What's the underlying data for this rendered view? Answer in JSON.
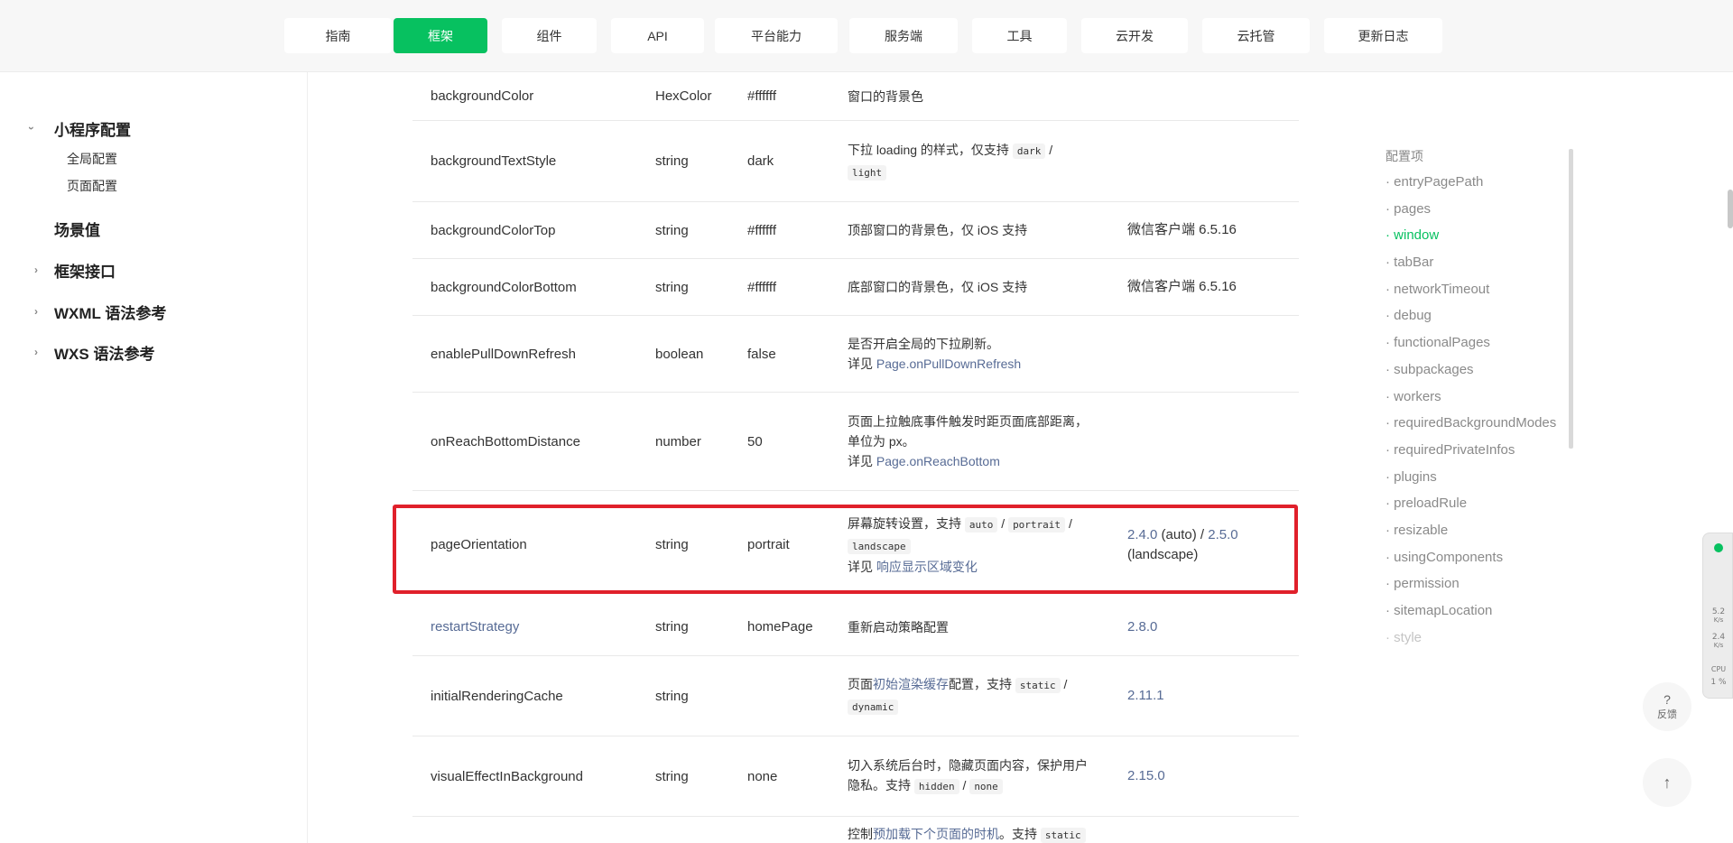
{
  "topnav": {
    "items": [
      "指南",
      "框架",
      "组件",
      "API",
      "平台能力",
      "服务端",
      "工具",
      "云开发",
      "云托管",
      "更新日志"
    ],
    "active": "框架"
  },
  "sidebar": {
    "items": [
      {
        "label": "小程序配置",
        "expanded": true
      },
      {
        "label": "全局配置"
      },
      {
        "label": "页面配置"
      },
      {
        "label": "场景值"
      },
      {
        "label": "框架接口",
        "expanded": false
      },
      {
        "label": "WXML 语法参考",
        "expanded": false
      },
      {
        "label": "WXS 语法参考",
        "expanded": false
      }
    ]
  },
  "table": {
    "rows": [
      {
        "prop": "backgroundColor",
        "type": "HexColor",
        "default": "#ffffff",
        "desc": "窗口的背景色",
        "version": ""
      },
      {
        "prop": "backgroundTextStyle",
        "type": "string",
        "default": "dark",
        "desc": "下拉 loading 的样式，仅支持",
        "code1": "dark",
        "sep": "/",
        "code2": "light",
        "version": ""
      },
      {
        "prop": "backgroundColorTop",
        "type": "string",
        "default": "#ffffff",
        "desc": "顶部窗口的背景色，仅 iOS 支持",
        "version": "微信客户端 6.5.16"
      },
      {
        "prop": "backgroundColorBottom",
        "type": "string",
        "default": "#ffffff",
        "desc": "底部窗口的背景色，仅 iOS 支持",
        "version": "微信客户端 6.5.16"
      },
      {
        "prop": "enablePullDownRefresh",
        "type": "boolean",
        "default": "false",
        "desc": "是否开启全局的下拉刷新。",
        "see": "详见",
        "link": "Page.onPullDownRefresh",
        "version": ""
      },
      {
        "prop": "onReachBottomDistance",
        "type": "number",
        "default": "50",
        "desc": "页面上拉触底事件触发时距页面底部距离，",
        "desc2": "单位为 px。",
        "see": "详见",
        "link": "Page.onReachBottom",
        "version": ""
      },
      {
        "prop": "pageOrientation",
        "type": "string",
        "default": "portrait",
        "desc": "屏幕旋转设置，支持",
        "code1": "auto",
        "sep": "/",
        "code2": "portrait",
        "code3": "landscape",
        "see": "详见",
        "link": "响应显示区域变化",
        "v1": "2.4.0",
        "v1note": "(auto) /",
        "v2": "2.5.0",
        "v2note": "(landscape)"
      },
      {
        "prop": "restartStrategy",
        "type": "string",
        "default": "homePage",
        "desc": "重新启动策略配置",
        "version": "2.8.0"
      },
      {
        "prop": "initialRenderingCache",
        "type": "string",
        "default": "",
        "desc_pre": "页面",
        "desc_link": "初始渲染缓存",
        "desc_post": "配置，支持",
        "code1": "static",
        "sep": "/",
        "code2": "dynamic",
        "version": "2.11.1"
      },
      {
        "prop": "visualEffectInBackground",
        "type": "string",
        "default": "none",
        "desc": "切入系统后台时，隐藏页面内容，保护用户",
        "desc2": "隐私。支持",
        "code1": "hidden",
        "sep": "/",
        "code2": "none",
        "version": "2.15.0"
      },
      {
        "desc_pre": "控制",
        "desc_link": "预加载下个页面的时机",
        "desc_post": "。支持",
        "code1": "static"
      }
    ]
  },
  "toc": {
    "title": "配置项",
    "items": [
      "entryPagePath",
      "pages",
      "window",
      "tabBar",
      "networkTimeout",
      "debug",
      "functionalPages",
      "subpackages",
      "workers",
      "requiredBackgroundModes",
      "requiredPrivateInfos",
      "plugins",
      "preloadRule",
      "resizable",
      "usingComponents",
      "permission",
      "sitemapLocation",
      "style"
    ],
    "active": "window"
  },
  "monitor": {
    "up_value": "5.2",
    "up_unit": "K/s",
    "down_value": "2.4",
    "down_unit": "K/s",
    "cpu_label": "CPU",
    "cpu_value": "1 %"
  },
  "float": {
    "feedback_icon": "?",
    "feedback_label": "反馈",
    "top_icon": "↑"
  },
  "colors": {
    "accent": "#07c160",
    "link": "#576b95",
    "highlight": "#e0202b"
  }
}
